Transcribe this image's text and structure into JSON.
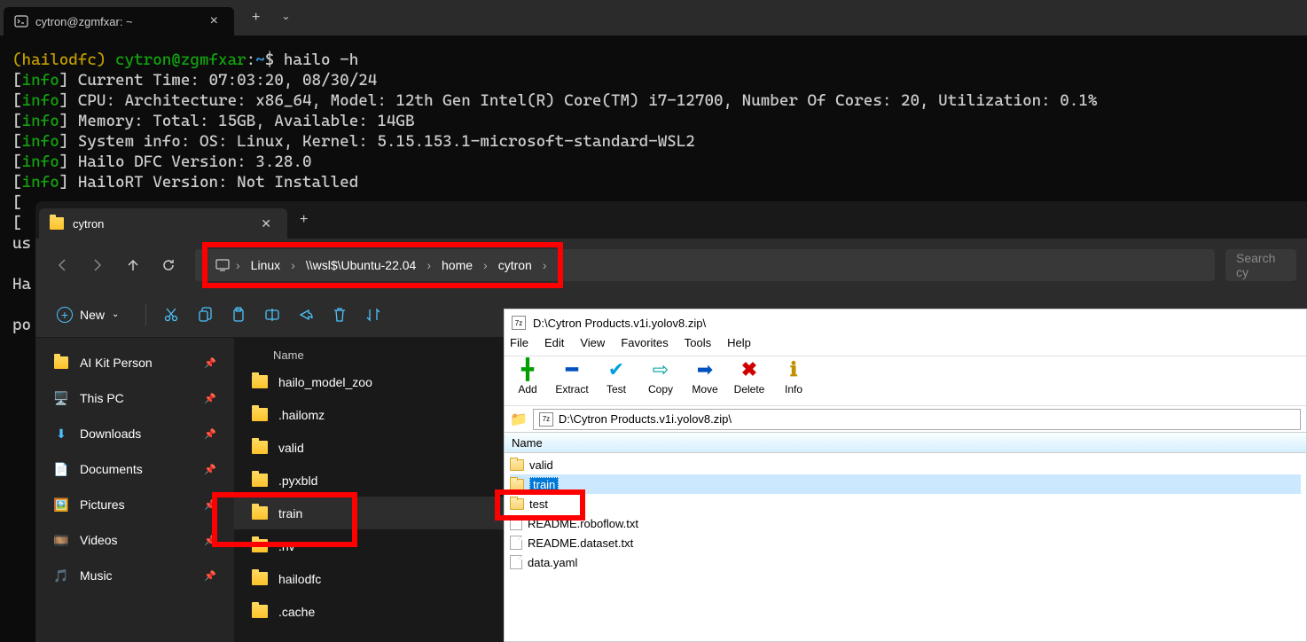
{
  "terminal": {
    "tab_title": "cytron@zgmfxar: ~",
    "prompt_env": "(hailodfc)",
    "prompt_user": "cytron@zgmfxar",
    "prompt_path": "~",
    "prompt_sym": "$",
    "command": "hailo -h",
    "lines": {
      "l1": "Current Time: 07:03:20, 08/30/24",
      "l2": "CPU: Architecture: x86_64, Model: 12th Gen Intel(R) Core(TM) i7-12700, Number Of Cores: 20, Utilization: 0.1%",
      "l3": "Memory: Total: 15GB, Available: 14GB",
      "l4": "System info: OS: Linux, Kernel: 5.15.153.1-microsoft-standard-WSL2",
      "l5": "Hailo DFC Version: 3.28.0",
      "l6": "HailoRT Version: Not Installed"
    },
    "tag": "info",
    "partial_us": "us",
    "partial_ha": "Ha",
    "partial_po": "po"
  },
  "explorer": {
    "tab_title": "cytron",
    "breadcrumb": {
      "b1": "Linux",
      "b2": "\\\\wsl$\\Ubuntu-22.04",
      "b3": "home",
      "b4": "cytron"
    },
    "search_placeholder": "Search cy",
    "new_label": "New",
    "sidebar": {
      "s0": "AI Kit Person",
      "s1": "This PC",
      "s2": "Downloads",
      "s3": "Documents",
      "s4": "Pictures",
      "s5": "Videos",
      "s6": "Music"
    },
    "header_name": "Name",
    "folders": {
      "f0": "hailo_model_zoo",
      "f1": ".hailomz",
      "f2": "valid",
      "f3": ".pyxbld",
      "f4": "train",
      "f5": ".nv",
      "f6": "hailodfc",
      "f7": ".cache"
    }
  },
  "sevenzip": {
    "title": "D:\\Cytron Products.v1i.yolov8.zip\\",
    "menu": {
      "m0": "File",
      "m1": "Edit",
      "m2": "View",
      "m3": "Favorites",
      "m4": "Tools",
      "m5": "Help"
    },
    "tools": {
      "t0": "Add",
      "t1": "Extract",
      "t2": "Test",
      "t3": "Copy",
      "t4": "Move",
      "t5": "Delete",
      "t6": "Info"
    },
    "path": "D:\\Cytron Products.v1i.yolov8.zip\\",
    "header_name": "Name",
    "items": {
      "i0": "valid",
      "i1": "train",
      "i2": "test",
      "i3": "README.roboflow.txt",
      "i4": "README.dataset.txt",
      "i5": "data.yaml"
    }
  }
}
